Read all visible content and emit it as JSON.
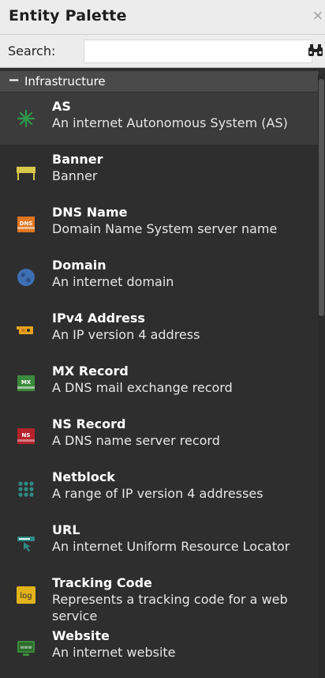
{
  "panel": {
    "title": "Entity Palette",
    "close_glyph": "×"
  },
  "search": {
    "label": "Search:",
    "value": "",
    "placeholder": ""
  },
  "group": {
    "toggle": "−",
    "label": "Infrastructure"
  },
  "entities": [
    {
      "name": "AS",
      "description": "An internet Autonomous System (AS)",
      "icon": "as-icon"
    },
    {
      "name": "Banner",
      "description": "Banner",
      "icon": "banner-icon"
    },
    {
      "name": "DNS Name",
      "description": "Domain Name System server name",
      "icon": "dns-name-icon",
      "icon_text": "DNS"
    },
    {
      "name": "Domain",
      "description": "An internet domain",
      "icon": "globe-icon"
    },
    {
      "name": "IPv4 Address",
      "description": "An IP version 4 address",
      "icon": "ipv4-icon"
    },
    {
      "name": "MX Record",
      "description": "A DNS mail exchange record",
      "icon": "mx-record-icon",
      "icon_text": "MX"
    },
    {
      "name": "NS Record",
      "description": "A DNS name server record",
      "icon": "ns-record-icon",
      "icon_text": "NS"
    },
    {
      "name": "Netblock",
      "description": "A range of IP version 4 addresses",
      "icon": "netblock-icon"
    },
    {
      "name": "URL",
      "description": "An internet Uniform Resource Locator",
      "icon": "url-icon"
    },
    {
      "name": "Tracking Code",
      "description": "Represents a tracking code for a web",
      "description_cont": "service",
      "icon": "tracking-code-icon",
      "icon_text": "log"
    },
    {
      "name": "Website",
      "description": "An internet website",
      "icon": "website-icon",
      "icon_text": "www"
    }
  ],
  "colors": {
    "background": "#2e2e2e",
    "header_bg": "#ececec",
    "group_bg": "#4a4a4a",
    "selected_bg": "#3b3b3b",
    "dns_orange": "#e0761f",
    "mx_green": "#3c8a3c",
    "ns_red": "#b4222c",
    "banner_yellow": "#d7c84a",
    "domain_blue": "#3e6fb3",
    "ipv4_orange": "#e9a21c",
    "tracking_yellow": "#e2b31a",
    "teal": "#2e8a83"
  }
}
